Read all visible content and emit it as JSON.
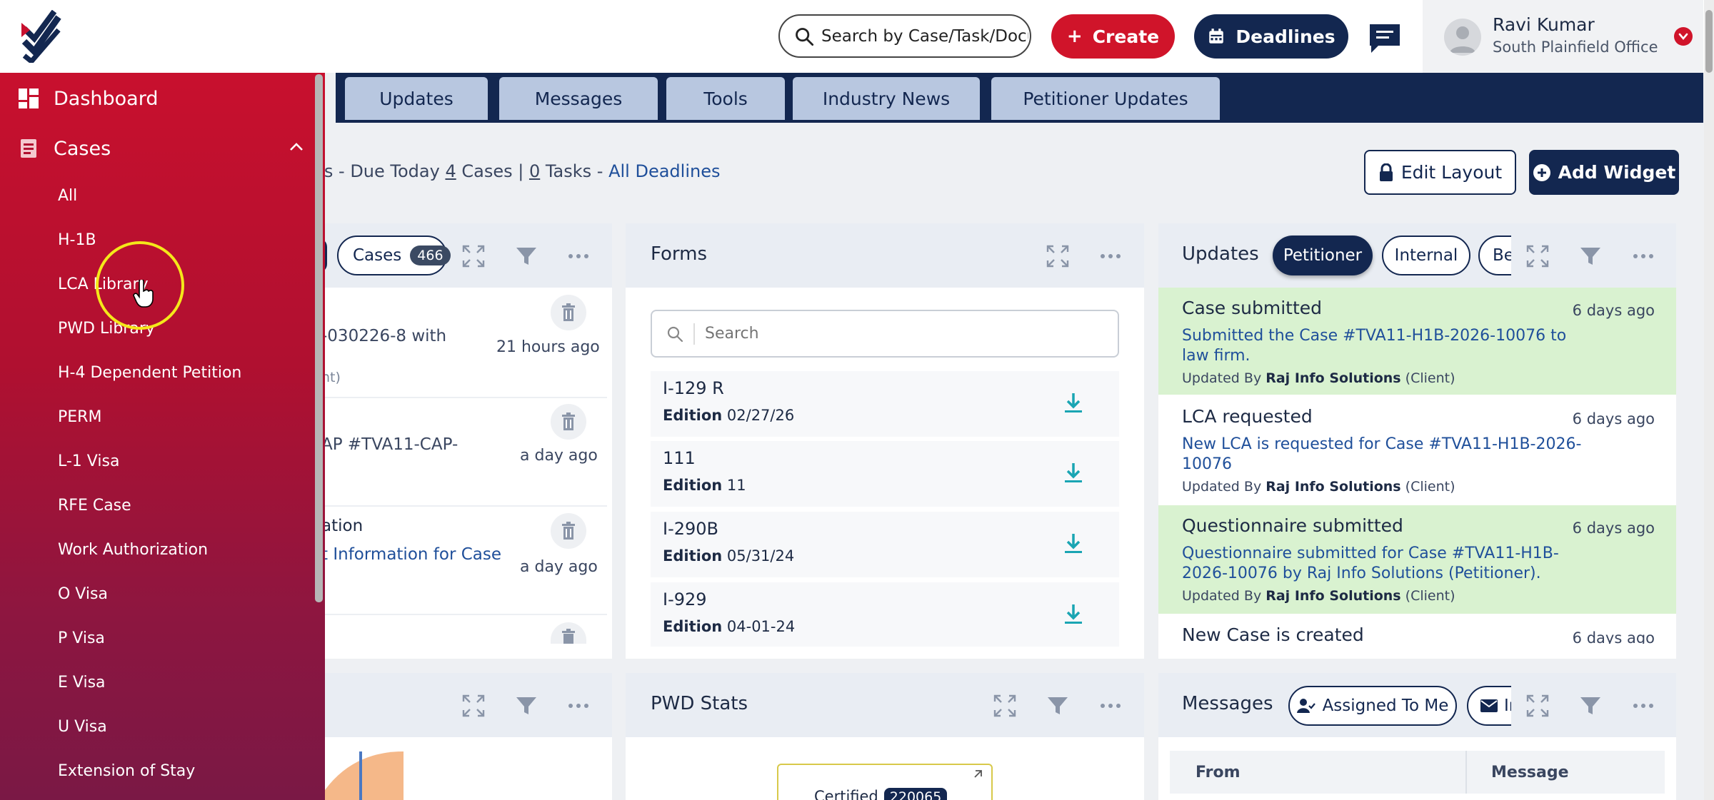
{
  "header": {
    "search_placeholder": "Search by Case/Task/Document",
    "create_label": "Create",
    "deadlines_label": "Deadlines",
    "user": {
      "name": "Ravi Kumar",
      "office": "South Plainfield Office"
    }
  },
  "tabs": [
    "Updates",
    "Messages",
    "Tools",
    "Industry News",
    "Petitioner Updates"
  ],
  "deadline_bar": {
    "prefix": "ks - Due Today ",
    "cases_count": "4",
    "cases_label": " Cases | ",
    "tasks_count": "0",
    "tasks_label": " Tasks - ",
    "all_deadlines": "All Deadlines"
  },
  "toolbar": {
    "edit_layout": "Edit Layout",
    "add_widget": "Add Widget"
  },
  "cases_widget": {
    "pill_label": "Cases",
    "pill_count": "466",
    "items": [
      {
        "line1": "-030226-8 with",
        "line2": "nt)",
        "ago": "21 hours ago"
      },
      {
        "line1": "AP #TVA11-CAP-",
        "line2": "",
        "ago": "a day ago"
      },
      {
        "line1": "ation",
        "line2": "t Information for Case",
        "ago": "a day ago"
      }
    ]
  },
  "forms_widget": {
    "title": "Forms",
    "search_placeholder": "Search",
    "edition_label": "Edition",
    "items": [
      {
        "name": "I-129 R",
        "edition": "02/27/26"
      },
      {
        "name": "111",
        "edition": "11"
      },
      {
        "name": "I-290B",
        "edition": "05/31/24"
      },
      {
        "name": "I-929",
        "edition": "04-01-24"
      }
    ]
  },
  "updates_widget": {
    "title": "Updates",
    "filters": [
      "Petitioner",
      "Internal",
      "Be"
    ],
    "by_prefix": "Updated By ",
    "items": [
      {
        "title": "Case submitted",
        "ago": "6 days ago",
        "desc": "Submitted the Case #TVA11-H1B-2026-10076 to law firm.",
        "by": "Raj Info Solutions",
        "role": "(Client)",
        "highlight": true
      },
      {
        "title": "LCA requested",
        "ago": "6 days ago",
        "desc": "New LCA is requested for Case #TVA11-H1B-2026-10076",
        "by": "Raj Info Solutions",
        "role": "(Client)",
        "highlight": false
      },
      {
        "title": "Questionnaire submitted",
        "ago": "6 days ago",
        "desc": "Questionnaire submitted for Case #TVA11-H1B-2026-10076 by Raj Info Solutions (Petitioner).",
        "by": "Raj Info Solutions",
        "role": "(Client)",
        "highlight": true
      },
      {
        "title": "New Case is created",
        "ago": "6 days ago",
        "desc": "",
        "by": "",
        "role": "",
        "highlight": false
      }
    ]
  },
  "pwd_widget": {
    "title": "PWD Stats",
    "certified_label": "Certified",
    "certified_count": "220065"
  },
  "messages_widget": {
    "title": "Messages",
    "filters": [
      "Assigned To Me",
      "In"
    ],
    "columns": [
      "From",
      "Message"
    ]
  },
  "sidebar": {
    "dashboard": "Dashboard",
    "cases": "Cases",
    "items": [
      "All",
      "H-1B",
      "LCA Library",
      "PWD Library",
      "H-4 Dependent Petition",
      "PERM",
      "L-1 Visa",
      "RFE Case",
      "Work Authorization",
      "O Visa",
      "P Visa",
      "E Visa",
      "U Visa",
      "Extension of Stay"
    ]
  },
  "colors": {
    "brand_red": "#c8102e",
    "navy": "#132750",
    "update_highlight": "#d9f2d0",
    "download": "#1aa5b3"
  }
}
